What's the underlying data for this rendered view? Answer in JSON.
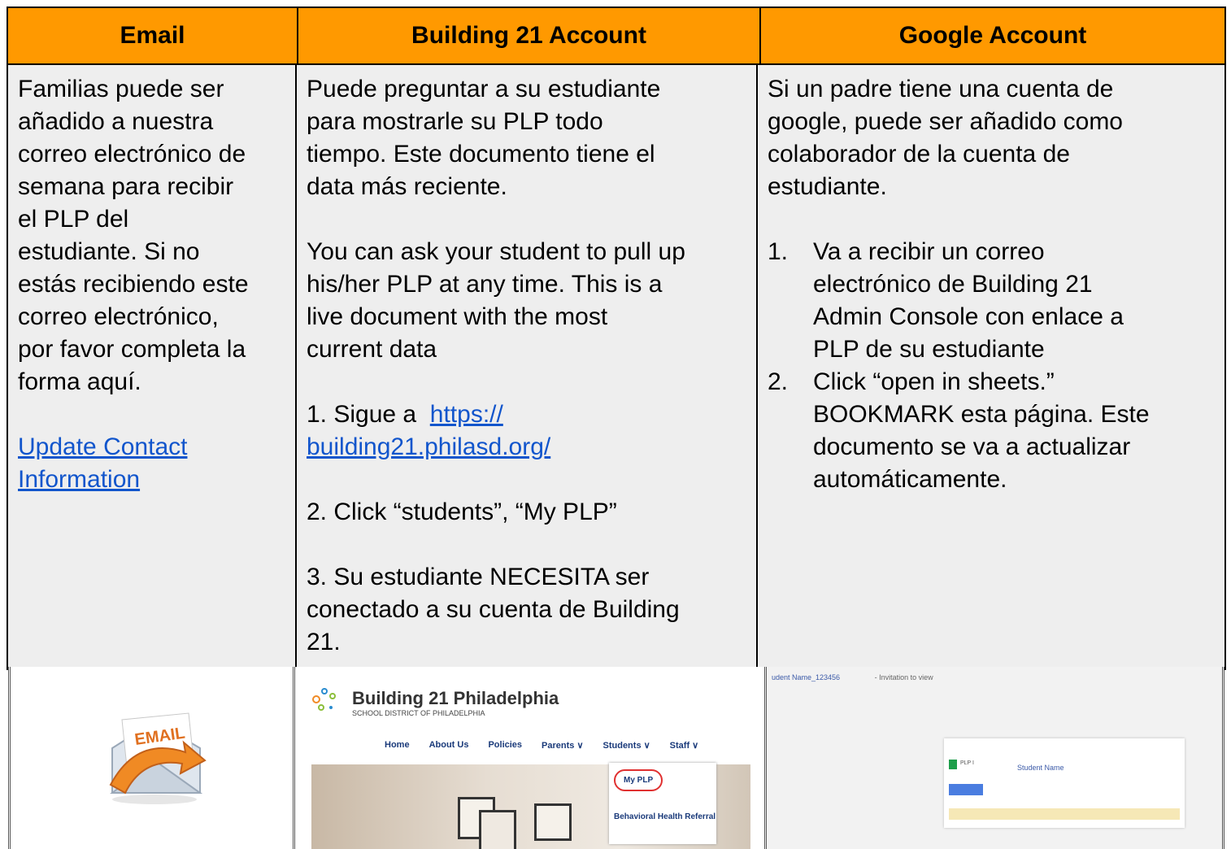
{
  "headers": [
    "Email",
    "Building 21 Account",
    "Google Account"
  ],
  "email_col": {
    "lines": [
      "Familias puede ser",
      "añadido a nuestra",
      "correo electrónico de",
      "semana para recibir",
      "el PLP del",
      "estudiante.  Si no",
      "estás recibiendo este",
      "correo electrónico,",
      "por favor completa la",
      "forma aquí."
    ],
    "link_lines": [
      "Update Contact",
      "Information"
    ]
  },
  "building_col": {
    "p1": [
      "Puede preguntar a su estudiante",
      "para mostrarle su PLP todo",
      "tiempo.  Este documento tiene el",
      "data más reciente."
    ],
    "p2": [
      "You can ask your student to pull up",
      "his/her PLP at any time.  This is a",
      "live document with the most",
      "current data"
    ],
    "step1_prefix": "1. Sigue a  ",
    "step1_link_a": "https://",
    "step1_link_b": "building21.philasd.org/",
    "step2": "2. Click “students”, “My PLP”",
    "step3": [
      "3. Su estudiante NECESITA ser",
      "conectado a su cuenta de Building",
      "21."
    ]
  },
  "google_col": {
    "p1": [
      "Si un padre tiene una cuenta de",
      "google, puede ser añadido como",
      "colaborador de la cuenta de",
      "estudiante."
    ],
    "items": [
      {
        "num": "1.",
        "lines": [
          "Va a recibir un correo",
          "electrónico de Building 21",
          "Admin Console con enlace a",
          "PLP de su estudiante"
        ]
      },
      {
        "num": "2.",
        "lines": [
          "Click “open in sheets.”",
          "BOOKMARK esta página.  Este",
          "documento se va a actualizar",
          "automáticamente."
        ]
      }
    ]
  },
  "images": {
    "email_icon_text": "EMAIL",
    "b21_title": "Building 21 Philadelphia",
    "b21_subtitle": "SCHOOL DISTRICT OF PHILADELPHIA",
    "b21_nav": [
      "Home",
      "About Us",
      "Policies",
      "Parents ∨",
      "Students ∨",
      "Staff ∨"
    ],
    "b21_menu_item1": "My PLP",
    "b21_menu_item2": "Behavioral Health Referral",
    "g_title": "udent Name_123456",
    "g_invite": "- Invitation to view",
    "g_student": "Student Name",
    "g_file": "PLP I"
  }
}
